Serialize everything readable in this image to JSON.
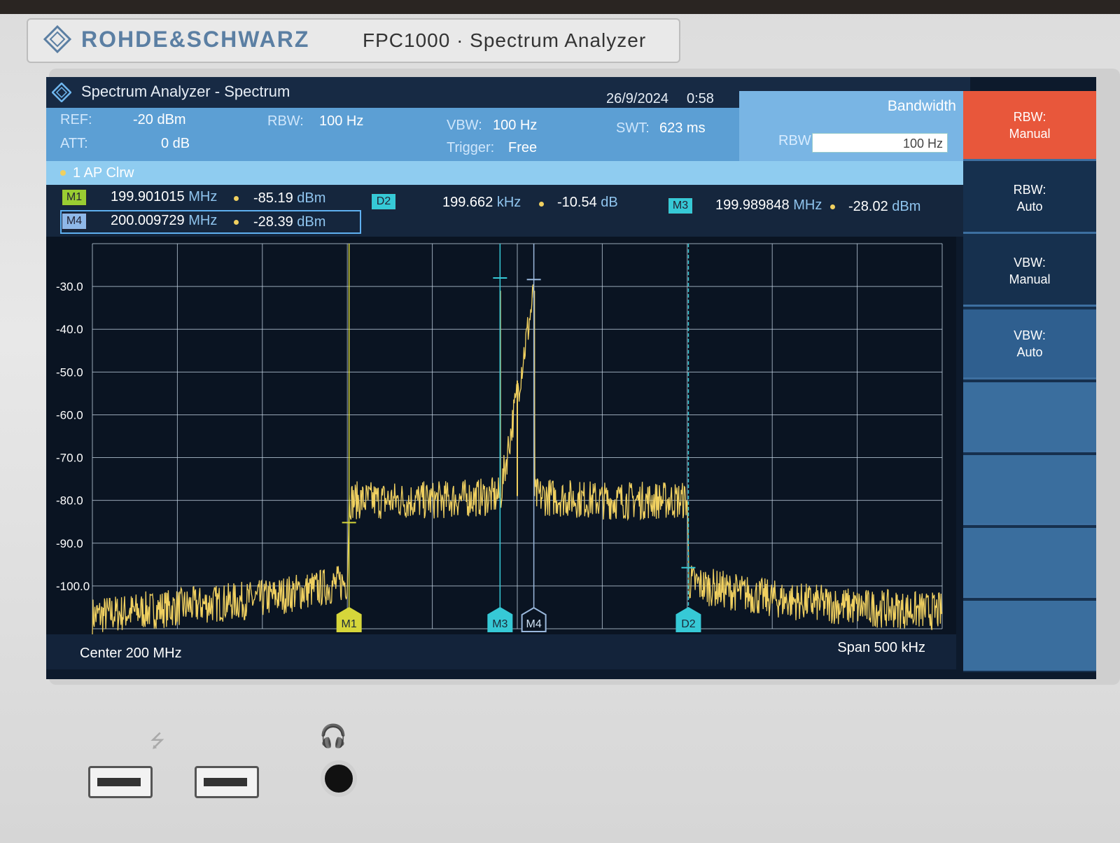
{
  "brand": {
    "name": "ROHDE&SCHWARZ",
    "model": "FPC1000 · Spectrum Analyzer"
  },
  "title": {
    "text": "Spectrum Analyzer - Spectrum",
    "date": "26/9/2024",
    "time": "0:58"
  },
  "settings": {
    "ref_label": "REF:",
    "ref_value": "-20 dBm",
    "att_label": "ATT:",
    "att_value": "0 dB",
    "rbw_label": "RBW:",
    "rbw_value": "100 Hz",
    "vbw_label": "VBW:",
    "vbw_value": "100 Hz",
    "trigger_label": "Trigger:",
    "trigger_value": "Free",
    "swt_label": "SWT:",
    "swt_value": "623 ms"
  },
  "bandwidth_panel": {
    "title": "Bandwidth",
    "rbw_label": "RBW",
    "rbw_input": "100 Hz"
  },
  "trace": {
    "label": "1 AP Clrw"
  },
  "markers": [
    {
      "tag": "M1",
      "freq": "199.901015",
      "freq_unit": "MHz",
      "level": "-85.19",
      "level_unit": "dBm",
      "color": "#9acd32"
    },
    {
      "tag": "D2",
      "freq": "199.662",
      "freq_unit": "kHz",
      "level": "-10.54",
      "level_unit": "dB",
      "color": "#36c9d6"
    },
    {
      "tag": "M3",
      "freq": "199.989848",
      "freq_unit": "MHz",
      "level": "-28.02",
      "level_unit": "dBm",
      "color": "#36c9d6"
    },
    {
      "tag": "M4",
      "freq": "200.009729",
      "freq_unit": "MHz",
      "level": "-28.39",
      "level_unit": "dBm",
      "color": "#8fb8e8"
    }
  ],
  "footer": {
    "center": "Center 200 MHz",
    "span": "Span 500 kHz"
  },
  "softkeys": [
    {
      "label1": "RBW:",
      "label2": "Manual"
    },
    {
      "label1": "RBW:",
      "label2": "Auto"
    },
    {
      "label1": "VBW:",
      "label2": "Manual"
    },
    {
      "label1": "VBW:",
      "label2": "Auto"
    }
  ],
  "chart_data": {
    "type": "line",
    "ylabel": "",
    "xlabel": "",
    "y_ticks": [
      "-30.0",
      "-40.0",
      "-50.0",
      "-60.0",
      "-70.0",
      "-80.0",
      "-90.0",
      "-100.0"
    ],
    "ylim": [
      -110,
      -20
    ],
    "xlim": [
      199.75,
      200.25
    ],
    "x_unit": "MHz",
    "grid": true,
    "trace_color": "#f0d060",
    "series": [
      {
        "x": [
          199.75,
          199.8,
          199.85,
          199.89,
          199.9,
          199.901,
          199.95,
          199.99,
          199.99,
          199.99,
          200.01,
          200.01,
          200.01,
          200.05,
          200.1,
          200.101,
          200.11,
          200.15,
          200.2,
          200.25
        ],
        "values": [
          -107,
          -105,
          -103,
          -100,
          -99,
          -80,
          -80,
          -79,
          -31,
          -79,
          -31,
          -79,
          -79,
          -80,
          -80,
          -99,
          -100,
          -103,
          -105,
          -106
        ]
      }
    ],
    "marker_positions": [
      {
        "tag": "M1",
        "x": 199.901015,
        "y": -85.19
      },
      {
        "tag": "M3",
        "x": 199.989848,
        "y": -28.02
      },
      {
        "tag": "M4",
        "x": 200.009729,
        "y": -28.39
      },
      {
        "tag": "D2",
        "x": 200.100677,
        "y": -95.73
      }
    ]
  }
}
